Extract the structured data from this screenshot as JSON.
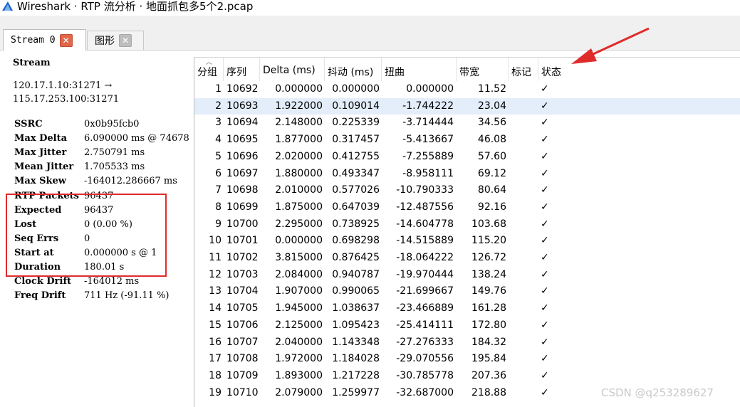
{
  "window": {
    "title": "Wireshark · RTP 流分析 · 地面抓包多5个2.pcap"
  },
  "tabs": [
    {
      "label": "Stream 0"
    },
    {
      "label": "图形"
    }
  ],
  "stream_info": {
    "heading": "Stream",
    "route_line1": "120.17.1.10:31271 →",
    "route_line2": "115.17.253.100:31271",
    "fields": [
      {
        "key": "SSRC",
        "value": "0x0b95fcb0"
      },
      {
        "key": "Max Delta",
        "value": "6.090000 ms @ 74678"
      },
      {
        "key": "Max Jitter",
        "value": "2.750791 ms"
      },
      {
        "key": "Mean Jitter",
        "value": "1.705533 ms"
      },
      {
        "key": "Max Skew",
        "value": "-164012.286667 ms"
      },
      {
        "key": "RTP Packets",
        "value": "96437"
      },
      {
        "key": "Expected",
        "value": "96437"
      },
      {
        "key": "Lost",
        "value": "0 (0.00 %)"
      },
      {
        "key": "Seq Errs",
        "value": "0"
      },
      {
        "key": "Start at",
        "value": "0.000000 s @ 1"
      },
      {
        "key": "Duration",
        "value": "180.01 s"
      },
      {
        "key": "Clock Drift",
        "value": "-164012 ms"
      },
      {
        "key": "Freq Drift",
        "value": "711 Hz (-91.11 %)"
      }
    ]
  },
  "table": {
    "columns": [
      "分组",
      "序列",
      "Delta (ms)",
      "抖动 (ms)",
      "扭曲",
      "带宽",
      "标记",
      "状态"
    ],
    "rows": [
      [
        "1",
        "10692",
        "0.000000",
        "0.000000",
        "0.000000",
        "11.52",
        "",
        "✓"
      ],
      [
        "2",
        "10693",
        "1.922000",
        "0.109014",
        "-1.744222",
        "23.04",
        "",
        "✓"
      ],
      [
        "3",
        "10694",
        "2.148000",
        "0.225339",
        "-3.714444",
        "34.56",
        "",
        "✓"
      ],
      [
        "4",
        "10695",
        "1.877000",
        "0.317457",
        "-5.413667",
        "46.08",
        "",
        "✓"
      ],
      [
        "5",
        "10696",
        "2.020000",
        "0.412755",
        "-7.255889",
        "57.60",
        "",
        "✓"
      ],
      [
        "6",
        "10697",
        "1.880000",
        "0.493347",
        "-8.958111",
        "69.12",
        "",
        "✓"
      ],
      [
        "7",
        "10698",
        "2.010000",
        "0.577026",
        "-10.790333",
        "80.64",
        "",
        "✓"
      ],
      [
        "8",
        "10699",
        "1.875000",
        "0.647039",
        "-12.487556",
        "92.16",
        "",
        "✓"
      ],
      [
        "9",
        "10700",
        "2.295000",
        "0.738925",
        "-14.604778",
        "103.68",
        "",
        "✓"
      ],
      [
        "10",
        "10701",
        "0.000000",
        "0.698298",
        "-14.515889",
        "115.20",
        "",
        "✓"
      ],
      [
        "11",
        "10702",
        "3.815000",
        "0.876425",
        "-18.064222",
        "126.72",
        "",
        "✓"
      ],
      [
        "12",
        "10703",
        "2.084000",
        "0.940787",
        "-19.970444",
        "138.24",
        "",
        "✓"
      ],
      [
        "13",
        "10704",
        "1.907000",
        "0.990065",
        "-21.699667",
        "149.76",
        "",
        "✓"
      ],
      [
        "14",
        "10705",
        "1.945000",
        "1.038637",
        "-23.466889",
        "161.28",
        "",
        "✓"
      ],
      [
        "15",
        "10706",
        "2.125000",
        "1.095423",
        "-25.414111",
        "172.80",
        "",
        "✓"
      ],
      [
        "16",
        "10707",
        "2.040000",
        "1.143348",
        "-27.276333",
        "184.32",
        "",
        "✓"
      ],
      [
        "17",
        "10708",
        "1.972000",
        "1.184028",
        "-29.070556",
        "195.84",
        "",
        "✓"
      ],
      [
        "18",
        "10709",
        "1.893000",
        "1.217228",
        "-30.785778",
        "207.36",
        "",
        "✓"
      ],
      [
        "19",
        "10710",
        "2.079000",
        "1.259977",
        "-32.687000",
        "218.88",
        "",
        "✓"
      ]
    ],
    "selected_row": 1
  },
  "watermark": "CSDN @q253289627",
  "colors": {
    "highlight_box": "#e02b2b",
    "arrow": "#e02b2b",
    "selected_row": "#e4eefb",
    "tab_close_active": "#e0674a"
  }
}
